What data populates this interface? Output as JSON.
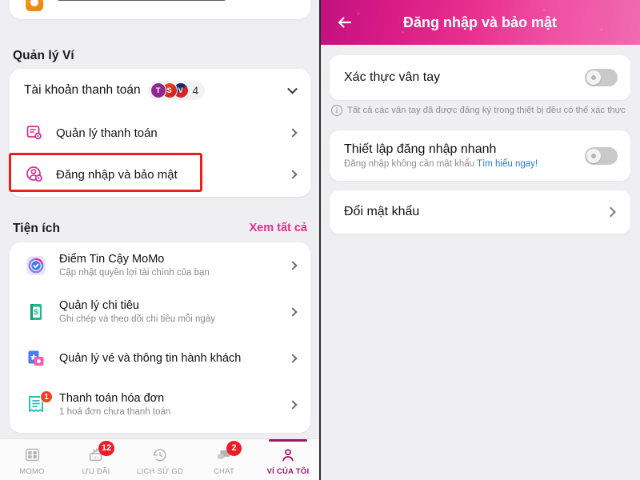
{
  "left": {
    "top_cut_card": {
      "icon": "orange-rounded-icon"
    },
    "wallet_section": {
      "title": "Quản lý Ví",
      "account_row": {
        "label": "Tài khoản thanh toán",
        "bank_badges": [
          "T",
          "S",
          "V"
        ],
        "count": "4",
        "chevron": "chevron-down-icon"
      },
      "items": [
        {
          "label": "Quản lý thanh toán",
          "icon": "payment-management-icon",
          "chevron": "chevron-right-icon"
        },
        {
          "label": "Đăng nhập và bảo mật",
          "icon": "login-security-icon",
          "chevron": "chevron-right-icon",
          "highlighted": true
        }
      ]
    },
    "utility_section": {
      "title": "Tiện ích",
      "see_all": "Xem tất cả",
      "items": [
        {
          "title": "Điểm Tin Cậy MoMo",
          "subtitle": "Cập nhật quyền lợi tài chính của bạn",
          "icon": "trust-score-icon",
          "badge": ""
        },
        {
          "title": "Quản lý chi tiêu",
          "subtitle": "Ghi chép và theo dõi chi tiêu mỗi ngày",
          "icon": "spending-book-icon",
          "badge": ""
        },
        {
          "title": "Quản lý vé và thông tin hành khách",
          "subtitle": "",
          "icon": "ticket-icon",
          "badge": ""
        },
        {
          "title": "Thanh toán hóa đơn",
          "subtitle": "1 hoá đơn chưa thanh toán",
          "icon": "invoice-icon",
          "badge": "1"
        }
      ]
    },
    "bottom_nav": [
      {
        "label": "MOMO",
        "icon": "momo-logo-icon",
        "badge": "",
        "active": false
      },
      {
        "label": "ƯU ĐÃI",
        "icon": "gift-voucher-icon",
        "badge": "12",
        "active": false
      },
      {
        "label": "LỊCH SỬ GD",
        "icon": "history-clock-icon",
        "badge": "",
        "active": false
      },
      {
        "label": "CHAT",
        "icon": "chat-bubble-icon",
        "badge": "2",
        "active": false
      },
      {
        "label": "VÍ CỦA TÔI",
        "icon": "person-icon",
        "badge": "",
        "active": true
      }
    ]
  },
  "right": {
    "header": {
      "title": "Đăng nhập và bảo mật",
      "back_icon": "arrow-left-icon"
    },
    "fingerprint": {
      "title": "Xác thực vân tay",
      "toggle_state": "off"
    },
    "info_note": {
      "icon": "info-circle-icon",
      "text": "Tất cả các vân tay đã được đăng ký trong thiết bị đều có thể xác thực"
    },
    "quick_login": {
      "title": "Thiết lập đăng nhập nhanh",
      "subtitle": "Đăng nhập không cần mật khẩu",
      "link": "Tìm hiểu ngay!",
      "toggle_state": "off"
    },
    "change_password": {
      "title": "Đổi mật khẩu",
      "chevron": "chevron-right-icon",
      "highlighted": true
    }
  },
  "annotations": {
    "highlight_color": "#e8221b",
    "brand_pink": "#e62e8b",
    "accent_purple": "#a4156e"
  }
}
